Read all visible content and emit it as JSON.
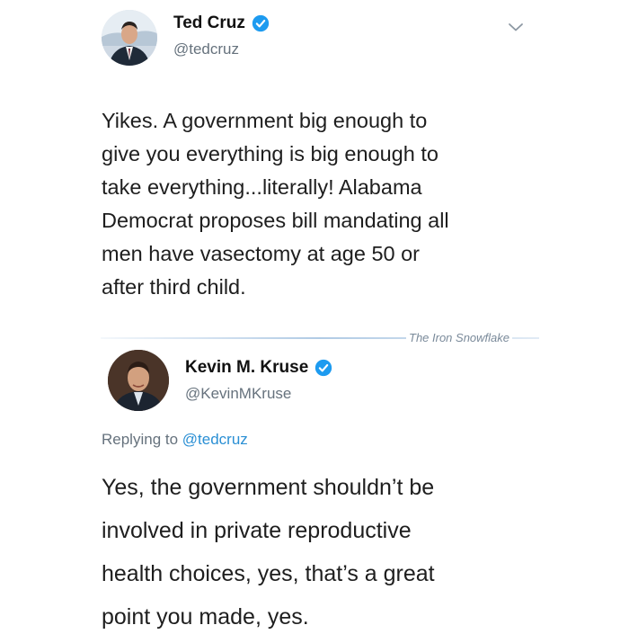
{
  "tweets": [
    {
      "display_name": "Ted Cruz",
      "handle": "@tedcruz",
      "verified": true,
      "text_lines": [
        "Yikes.  A government big enough to",
        "give you everything is big enough to",
        "take everything...literally! Alabama",
        "Democrat proposes bill mandating all",
        "men have vasectomy at age 50 or",
        "after third child."
      ]
    },
    {
      "display_name": "Kevin M. Kruse",
      "handle": "@KevinMKruse",
      "verified": true,
      "replying_to_prefix": "Replying to",
      "replying_to_handle": "@tedcruz",
      "text_lines": [
        "Yes, the government shouldn’t be",
        "involved in private reproductive",
        "health choices, yes, that’s a great",
        "point you made, yes."
      ]
    }
  ],
  "watermark": "The Iron Snowflake",
  "colors": {
    "verified_badge": "#1d9bf0",
    "mention": "#2a8fd4",
    "secondary_text": "#66727d"
  },
  "icons": {
    "verified": "verified-badge-icon",
    "menu": "chevron-down-icon"
  }
}
